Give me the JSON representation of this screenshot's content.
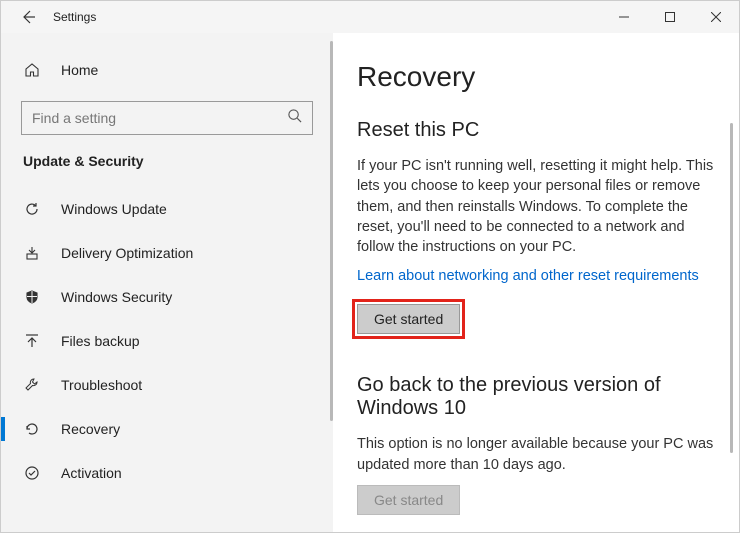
{
  "titlebar": {
    "title": "Settings"
  },
  "sidebar": {
    "home_label": "Home",
    "search_placeholder": "Find a setting",
    "category": "Update & Security",
    "items": [
      {
        "label": "Windows Update"
      },
      {
        "label": "Delivery Optimization"
      },
      {
        "label": "Windows Security"
      },
      {
        "label": "Files backup"
      },
      {
        "label": "Troubleshoot"
      },
      {
        "label": "Recovery"
      },
      {
        "label": "Activation"
      }
    ]
  },
  "content": {
    "title": "Recovery",
    "reset": {
      "heading": "Reset this PC",
      "body": "If your PC isn't running well, resetting it might help. This lets you choose to keep your personal files or remove them, and then reinstalls Windows. To complete the reset, you'll need to be connected to a network and follow the instructions on your PC.",
      "link": "Learn about networking and other reset requirements",
      "button": "Get started"
    },
    "goback": {
      "heading": "Go back to the previous version of Windows 10",
      "body": "This option is no longer available because your PC was updated more than 10 days ago.",
      "button": "Get started"
    }
  }
}
